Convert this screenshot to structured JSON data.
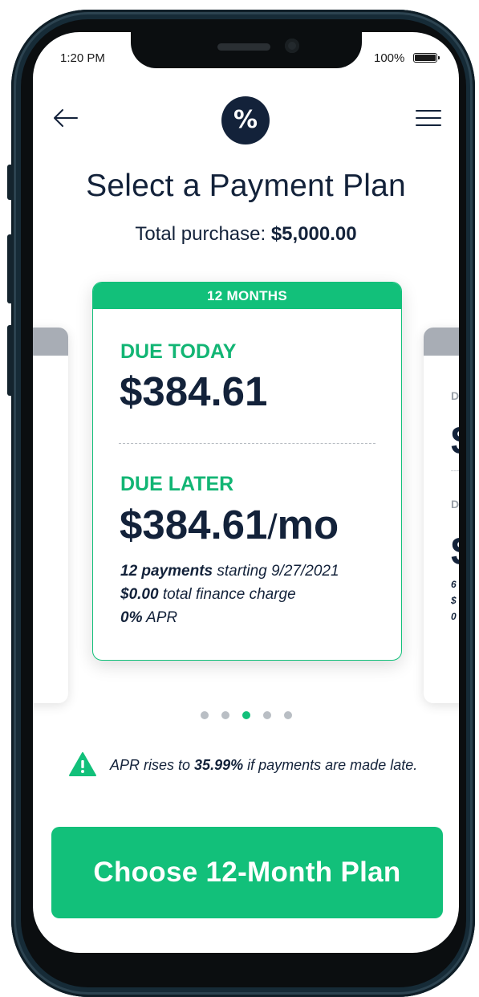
{
  "status_bar": {
    "time": "1:20 PM",
    "battery_pct": "100%"
  },
  "header": {
    "logo_glyph": "%",
    "back_icon": "arrow-left-icon",
    "menu_icon": "hamburger-menu-icon"
  },
  "page": {
    "title": "Select a Payment Plan",
    "total_label": "Total purchase:",
    "total_value": "$5,000.00"
  },
  "plan": {
    "term_label": "12 MONTHS",
    "due_today_label": "DUE TODAY",
    "due_today_amount": "$384.61",
    "due_later_label": "DUE LATER",
    "due_later_amount": "$384.61",
    "due_later_slash": "/",
    "due_later_unit": "mo",
    "payments_count": "12 payments",
    "payments_start": "starting 9/27/2021",
    "finance_amount": "$0.00",
    "finance_label": "total finance charge",
    "apr_value": "0%",
    "apr_label": "APR"
  },
  "peek_right": {
    "due_today_initial": "D",
    "amount_initial": "$",
    "due_later_initial": "D",
    "amount_later_initial": "$",
    "line1": "6",
    "line2": "$",
    "line3": "0"
  },
  "carousel": {
    "dot_count": 5,
    "active_index": 2
  },
  "warning": {
    "icon": "warning-triangle-icon",
    "prefix": "APR rises to",
    "rate": "35.99%",
    "suffix": "if payments are made late."
  },
  "cta": {
    "label": "Choose 12-Month Plan"
  },
  "colors": {
    "accent": "#12c07a",
    "navy": "#13223a",
    "inactive": "#a8adb5"
  }
}
